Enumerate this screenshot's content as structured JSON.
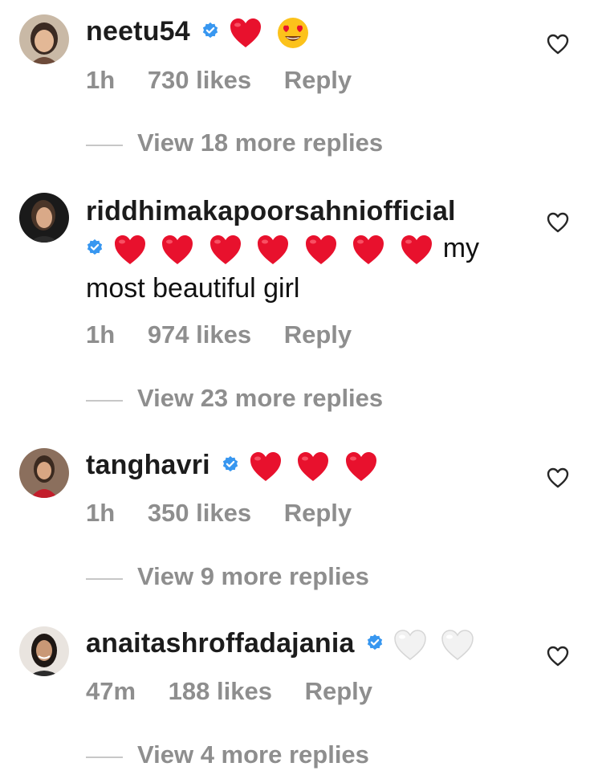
{
  "comments": [
    {
      "username": "neetu54",
      "verified": true,
      "emojis": [
        "red-heart",
        "heart-eyes-face"
      ],
      "text": "",
      "time": "1h",
      "likes": "730 likes",
      "reply_label": "Reply",
      "view_replies": "View 18 more replies"
    },
    {
      "username": "riddhimakapoorsahniofficial",
      "verified": true,
      "emojis": [
        "red-heart",
        "red-heart",
        "red-heart",
        "red-heart",
        "red-heart",
        "red-heart",
        "red-heart"
      ],
      "text_part1": "my",
      "text_part2": "most beautiful girl",
      "time": "1h",
      "likes": "974 likes",
      "reply_label": "Reply",
      "view_replies": "View 23 more replies"
    },
    {
      "username": "tanghavri",
      "verified": true,
      "emojis": [
        "red-heart",
        "red-heart",
        "red-heart"
      ],
      "text": "",
      "time": "1h",
      "likes": "350 likes",
      "reply_label": "Reply",
      "view_replies": "View 9 more replies"
    },
    {
      "username": "anaitashroffadajania",
      "verified": true,
      "emojis": [
        "white-heart",
        "white-heart"
      ],
      "text": "",
      "time": "47m",
      "likes": "188 likes",
      "reply_label": "Reply",
      "view_replies": "View 4 more replies"
    }
  ],
  "colors": {
    "username": "#1c1c1c",
    "meta": "#8e8e8e",
    "verified": "#3897f0",
    "red_heart": "#e8112d"
  }
}
